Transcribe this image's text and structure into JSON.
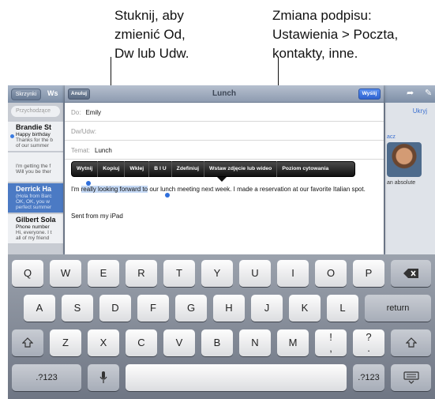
{
  "callouts": {
    "from_field": [
      "Stuknij, aby",
      "zmienić Od,",
      "Dw lub Udw."
    ],
    "signature": [
      "Zmiana podpisu:",
      "Ustawienia > Poczta,",
      "kontakty, inne."
    ]
  },
  "background_mail": {
    "mailboxes_button": "Skrzynki",
    "header_partial": "Ws",
    "search_placeholder": "Przychodzące",
    "hide_link": "Ukryj",
    "snippet_right": "an absolute",
    "snippet_right2": "acz",
    "messages": [
      {
        "sender": "Brandie St",
        "subject": "Happy birthday",
        "preview": "Thanks for the b",
        "preview2": "of our summer",
        "unread": true
      },
      {
        "sender": "",
        "subject": "",
        "preview": "I'm getting the f",
        "preview2": "Will you be ther",
        "unread": false
      },
      {
        "sender": "Derrick Ha",
        "subject": "(Hola from Barc",
        "preview": "OK, OK, you w",
        "preview2": "perfect summer",
        "unread": false,
        "selected": true
      },
      {
        "sender": "Gilbert Sola",
        "subject": "Phone number",
        "preview": "Hi, everyone. I t",
        "preview2": "all of my friend",
        "unread": false
      }
    ]
  },
  "compose": {
    "title": "Lunch",
    "cancel_label": "Anuluj",
    "send_label": "Wyślij",
    "to_label": "Do:",
    "to_value": "Emily",
    "cc_label": "Dw/Udw:",
    "subject_label": "Temat:",
    "subject_value": "Lunch",
    "body_before": "I'm ",
    "body_selected": "really looking forward to",
    "body_after": " our lunch meeting next week. I made a reservation at our favorite Italian spot.",
    "signature": "Sent from my iPad"
  },
  "edit_menu": [
    "Wytnij",
    "Kopiuj",
    "Wklej",
    "B I U",
    "Zdefiniuj",
    "Wstaw zdjęcie lub wideo",
    "Poziom cytowania"
  ],
  "keyboard": {
    "row1": [
      "Q",
      "W",
      "E",
      "R",
      "T",
      "Y",
      "U",
      "I",
      "O",
      "P"
    ],
    "row2": [
      "A",
      "S",
      "D",
      "F",
      "G",
      "H",
      "J",
      "K",
      "L"
    ],
    "row3": [
      "Z",
      "X",
      "C",
      "V",
      "B",
      "N",
      "M",
      "!",
      "?"
    ],
    "row3_sub": [
      ",",
      "."
    ],
    "return_label": "return",
    "numbers_label": ".?123",
    "shift_icon": "shift-icon",
    "delete_icon": "delete-icon",
    "mic_icon": "microphone-icon",
    "hide_keyboard_icon": "hide-keyboard-icon"
  }
}
